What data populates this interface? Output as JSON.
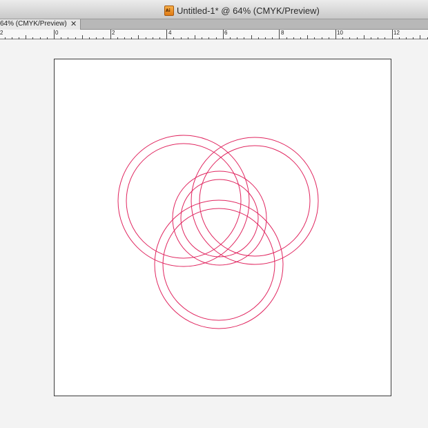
{
  "window": {
    "title": "Untitled-1* @ 64% (CMYK/Preview)",
    "app_icon_letters": "Ai",
    "app_icon": "illustrator-document-icon"
  },
  "tab": {
    "label": "64% (CMYK/Preview)",
    "close_glyph": "✕"
  },
  "ruler": {
    "labels": [
      "2",
      "0",
      "2",
      "4",
      "6",
      "8",
      "10",
      "12"
    ]
  },
  "artwork": {
    "stroke_color": "#e0245e",
    "shapes": [
      "ring-top-left",
      "ring-top-right",
      "ring-center",
      "ring-bottom"
    ]
  }
}
